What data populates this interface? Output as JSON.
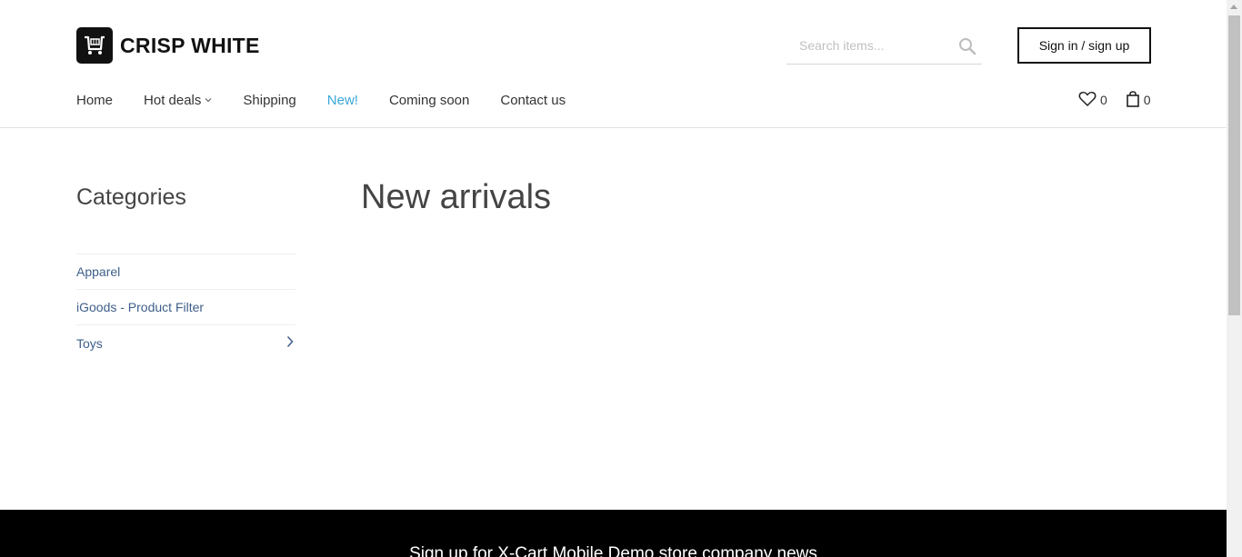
{
  "brand": {
    "name": "CRISP WHITE",
    "logo_icon": "cart-logo-icon"
  },
  "search": {
    "placeholder": "Search items...",
    "value": "",
    "icon": "search-icon"
  },
  "account": {
    "signin_label": "Sign in / sign up"
  },
  "nav": {
    "items": [
      {
        "label": "Home"
      },
      {
        "label": "Hot deals"
      },
      {
        "label": "Shipping"
      },
      {
        "label": "New!"
      },
      {
        "label": "Coming soon"
      },
      {
        "label": "Contact us"
      }
    ]
  },
  "header_counters": {
    "wishlist_count": "0",
    "cart_count": "0"
  },
  "sidebar": {
    "title": "Categories",
    "categories": [
      {
        "label": "Apparel"
      },
      {
        "label": "iGoods - Product Filter"
      },
      {
        "label": "Toys"
      }
    ]
  },
  "main": {
    "title": "New arrivals"
  },
  "footer": {
    "newsletter_text": "Sign up for X-Cart Mobile Demo store company news"
  },
  "colors": {
    "accent": "#3aa7d9",
    "category_link": "#3e5f8a",
    "footer_bg": "#000000"
  }
}
